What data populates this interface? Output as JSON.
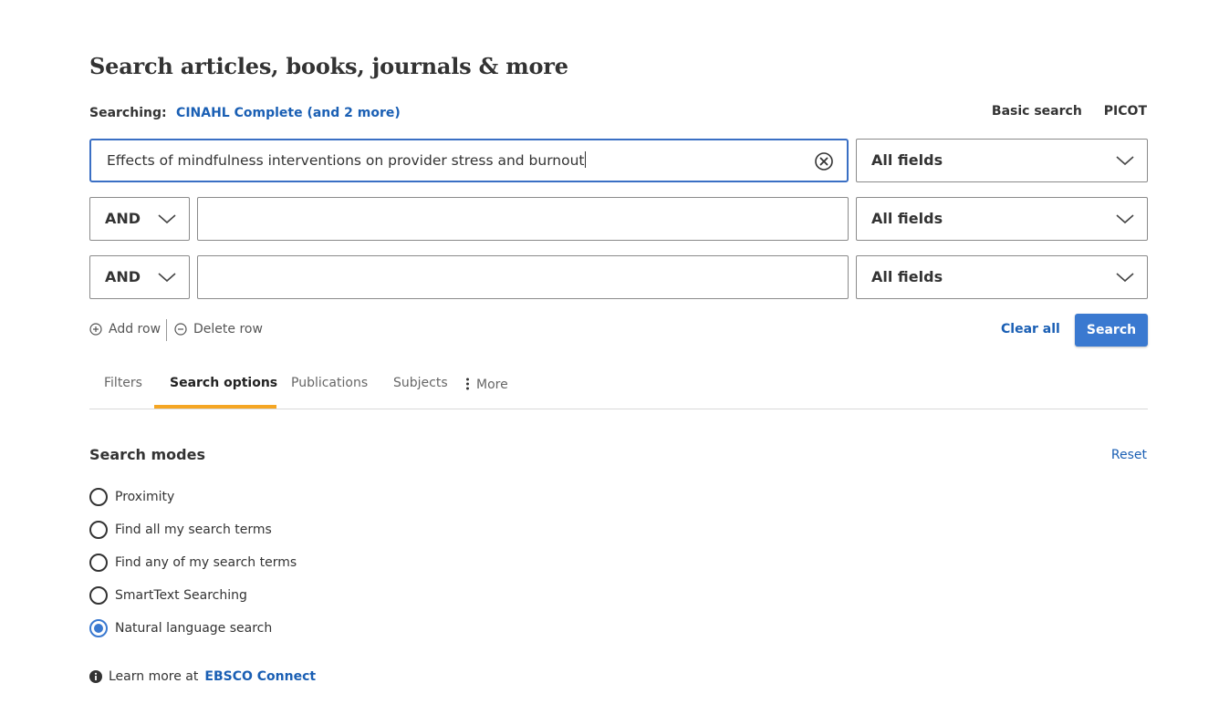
{
  "header": {
    "title": "Search articles, books, journals & more"
  },
  "searching": {
    "label": "Searching:",
    "databases": "CINAHL Complete (and 2 more)"
  },
  "mode_links": {
    "basic": "Basic search",
    "picot": "PICOT"
  },
  "rows": [
    {
      "operator": "",
      "query": "Effects of mindfulness interventions on provider stress and burnout",
      "field": "All fields"
    },
    {
      "operator": "AND",
      "query": "",
      "field": "All fields"
    },
    {
      "operator": "AND",
      "query": "",
      "field": "All fields"
    }
  ],
  "actions": {
    "add_row": "Add row",
    "delete_row": "Delete row",
    "clear_all": "Clear all",
    "search": "Search"
  },
  "tabs": [
    {
      "label": "Filters",
      "active": false
    },
    {
      "label": "Search options",
      "active": true
    },
    {
      "label": "Publications",
      "active": false
    },
    {
      "label": "Subjects",
      "active": false
    },
    {
      "label": "More",
      "active": false
    }
  ],
  "search_modes": {
    "title": "Search modes",
    "reset": "Reset",
    "options": [
      {
        "label": "Proximity",
        "selected": false
      },
      {
        "label": "Find all my search terms",
        "selected": false
      },
      {
        "label": "Find any of my search terms",
        "selected": false
      },
      {
        "label": "SmartText Searching",
        "selected": false
      },
      {
        "label": "Natural language search",
        "selected": true
      }
    ]
  },
  "learn_more": {
    "prefix": "Learn more at",
    "link": "EBSCO Connect"
  },
  "colors": {
    "accent": "#3a79d0",
    "link": "#1a5fb4",
    "tab_underline": "#f5a623"
  }
}
